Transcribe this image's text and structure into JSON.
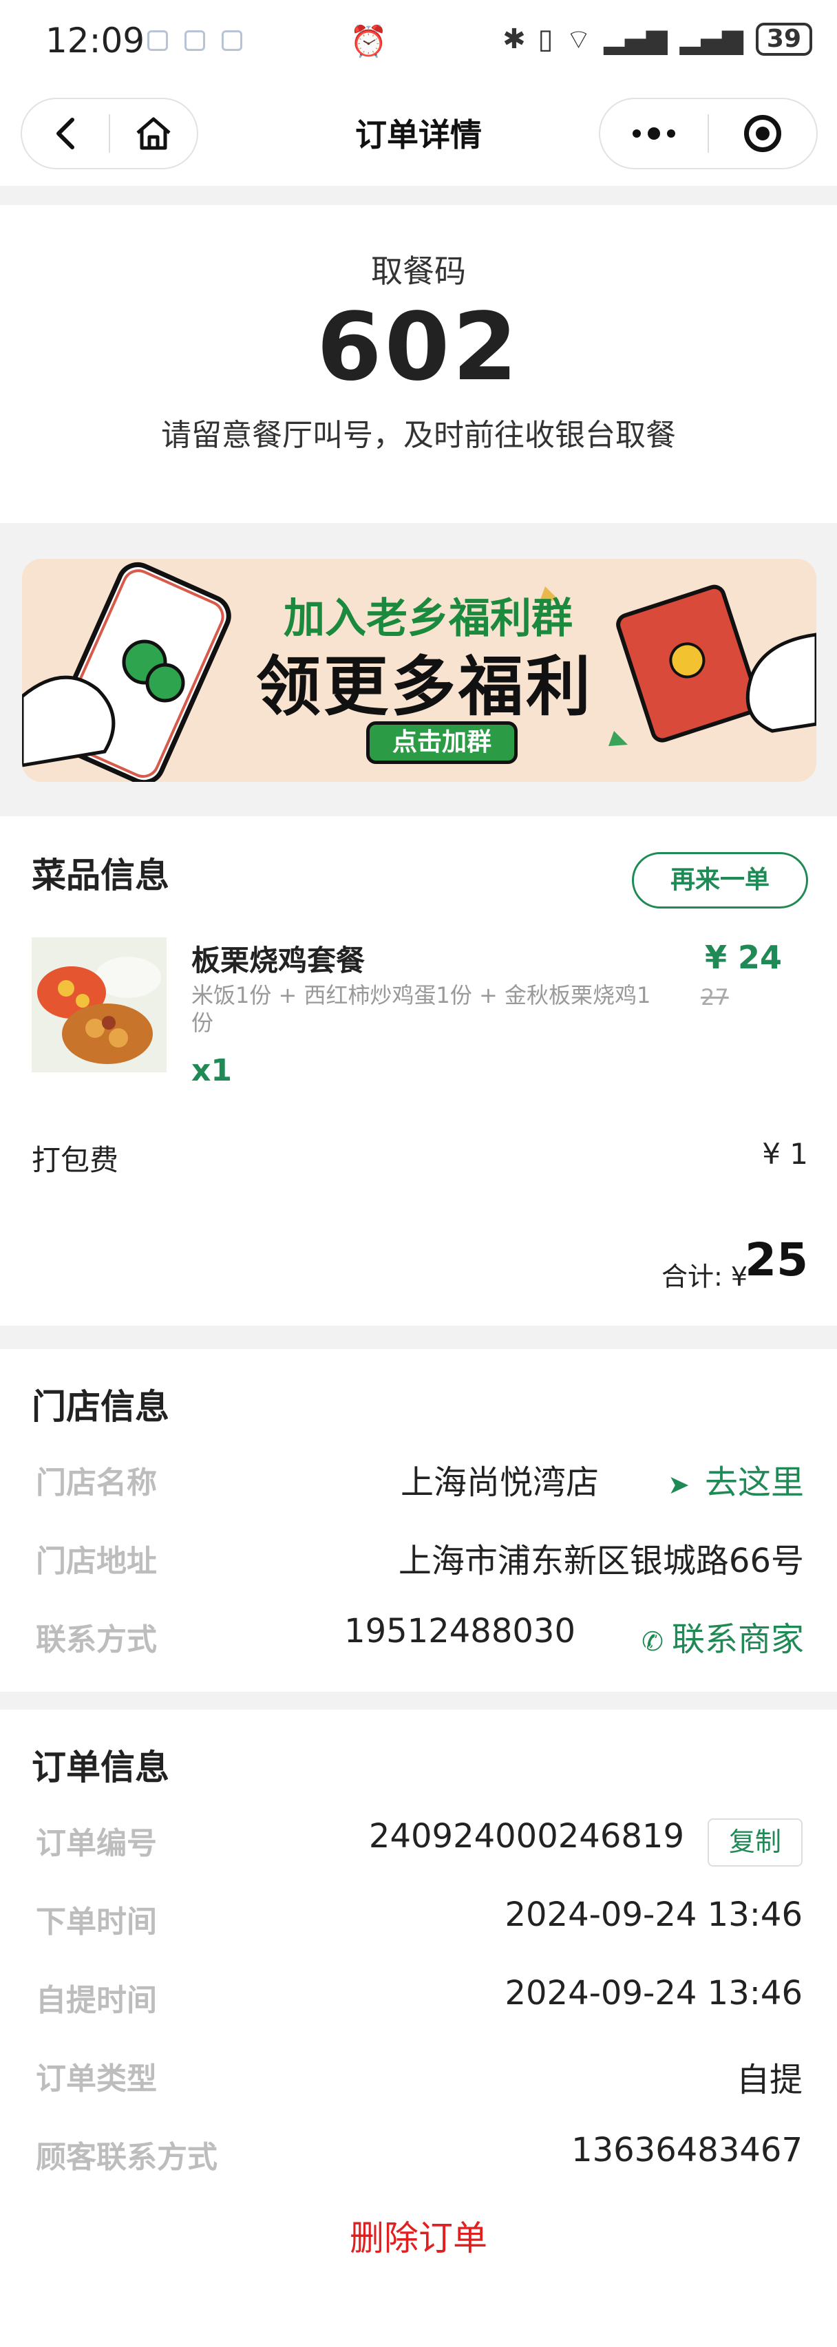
{
  "status_bar": {
    "time": "12:09",
    "battery": "39"
  },
  "nav": {
    "title": "订单详情"
  },
  "pickup": {
    "label": "取餐码",
    "code": "602",
    "hint": "请留意餐厅叫号，及时前往收银台取餐"
  },
  "banner": {
    "line1": "加入老乡福利群",
    "line2": "领更多福利",
    "button": "点击加群"
  },
  "dishes": {
    "title": "菜品信息",
    "reorder_label": "再来一单",
    "items": [
      {
        "name": "板栗烧鸡套餐",
        "desc": "米饭1份 + 西红柿炒鸡蛋1份 + 金秋板栗烧鸡1份",
        "qty": "x1",
        "price": "¥ 24",
        "original_price": "27"
      }
    ],
    "packing_label": "打包费",
    "packing_price": "¥ 1",
    "total_label": "合计: ¥",
    "total_value": "25"
  },
  "store": {
    "title": "门店信息",
    "rows": [
      {
        "label": "门店名称",
        "value": "上海尚悦湾店",
        "action": "去这里"
      },
      {
        "label": "门店地址",
        "value": "上海市浦东新区银城路66号"
      },
      {
        "label": "联系方式",
        "value": "19512488030",
        "action": "联系商家"
      }
    ]
  },
  "order": {
    "title": "订单信息",
    "copy_label": "复制",
    "rows": [
      {
        "label": "订单编号",
        "value": "240924000246819"
      },
      {
        "label": "下单时间",
        "value": "2024-09-24 13:46"
      },
      {
        "label": "自提时间",
        "value": "2024-09-24 13:46"
      },
      {
        "label": "订单类型",
        "value": "自提"
      },
      {
        "label": "顾客联系方式",
        "value": "13636483467"
      }
    ],
    "delete_label": "删除订单"
  },
  "colors": {
    "accent": "#1f8a55",
    "danger": "#e02020",
    "label_gray": "#bdbdbd"
  }
}
